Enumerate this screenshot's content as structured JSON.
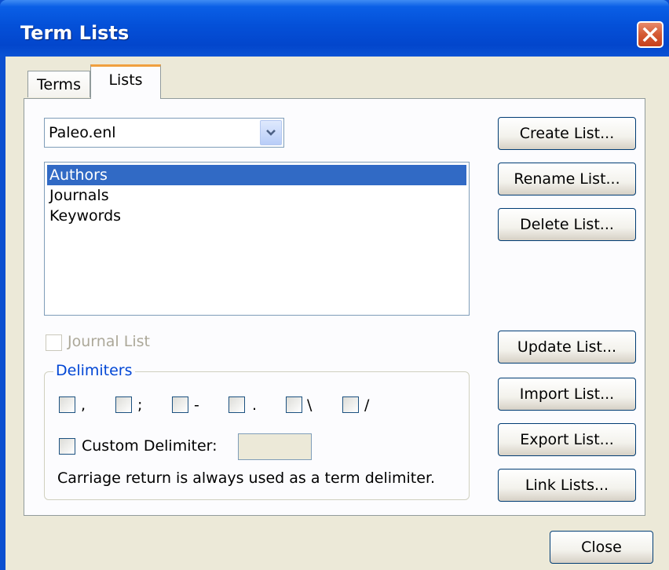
{
  "window": {
    "title": "Term Lists",
    "close_icon": "close-x-icon"
  },
  "tabs": [
    {
      "label": "Terms"
    },
    {
      "label": "Lists"
    }
  ],
  "library_select": {
    "value": "Paleo.enl",
    "icon": "chevron-down-icon"
  },
  "lists": {
    "items": [
      "Authors",
      "Journals",
      "Keywords"
    ],
    "selected": "Authors"
  },
  "journal_list_checkbox": {
    "label": "Journal List",
    "checked": false,
    "enabled": false
  },
  "delimiters": {
    "title": "Delimiters",
    "options": [
      {
        "label": ","
      },
      {
        "label": ";"
      },
      {
        "label": "-"
      },
      {
        "label": "."
      },
      {
        "label": "\\"
      },
      {
        "label": "/"
      }
    ],
    "custom_label": "Custom Delimiter:",
    "custom_value": "",
    "note": "Carriage return is always used as a term delimiter."
  },
  "buttons": {
    "create": "Create List...",
    "rename": "Rename List...",
    "delete": "Delete List...",
    "update": "Update List...",
    "import": "Import List...",
    "export": "Export List...",
    "link": "Link Lists...",
    "close": "Close"
  },
  "colors": {
    "titlebar": "#0450d8",
    "selection": "#316ac5",
    "dialog_bg": "#ece9d8",
    "group_title": "#0046d5"
  }
}
